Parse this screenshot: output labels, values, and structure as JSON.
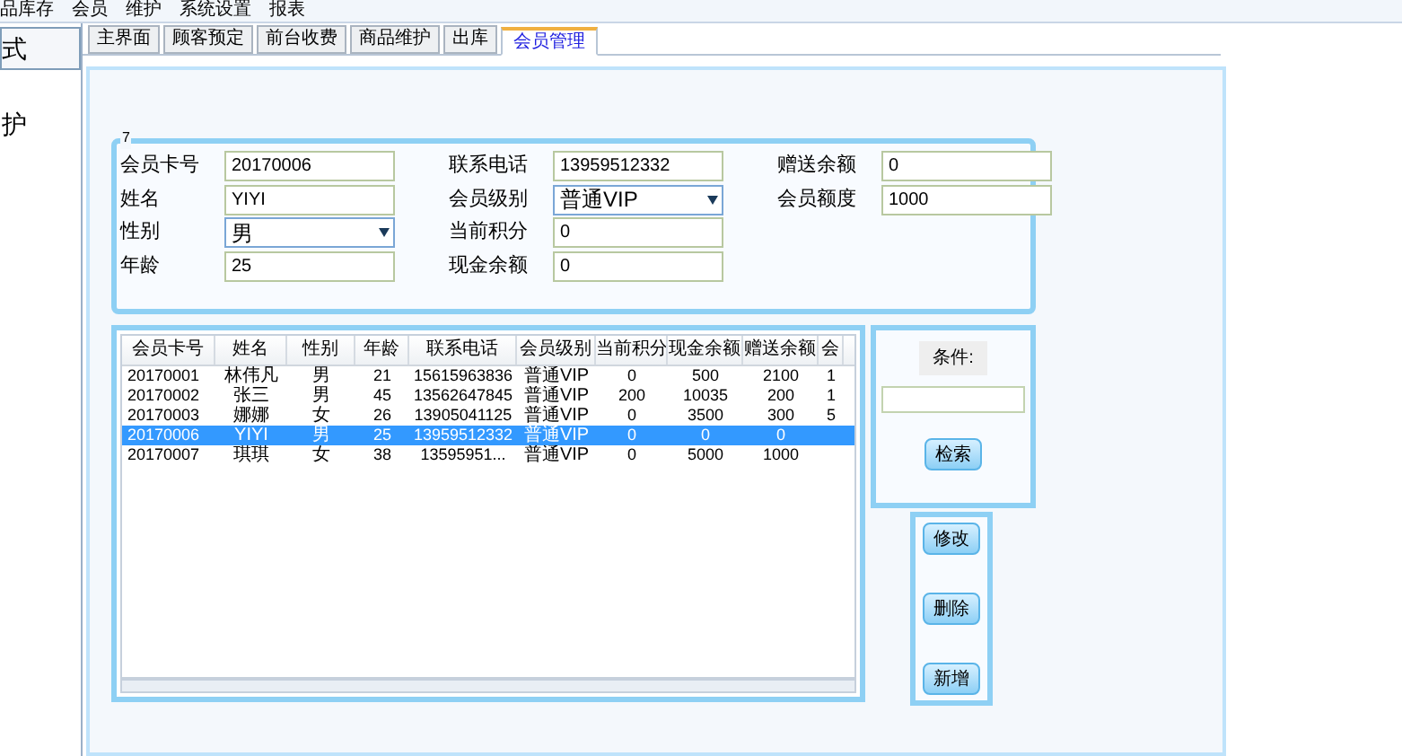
{
  "menu": [
    "品库存",
    "会员",
    "维护",
    "系统设置",
    "报表"
  ],
  "sidebar": [
    {
      "label": "式",
      "selected": true
    },
    {
      "label": "护",
      "selected": false
    }
  ],
  "tabs": [
    {
      "label": "主界面",
      "selected": false
    },
    {
      "label": "顾客预定",
      "selected": false
    },
    {
      "label": "前台收费",
      "selected": false
    },
    {
      "label": "商品维护",
      "selected": false
    },
    {
      "label": "出库",
      "selected": false
    },
    {
      "label": "会员管理",
      "selected": true
    }
  ],
  "form": {
    "title": "7",
    "fields": [
      {
        "label": "会员卡号",
        "value": "20170006",
        "kind": "text"
      },
      {
        "label": "联系电话",
        "value": "13959512332",
        "kind": "text"
      },
      {
        "label": "赠送余额",
        "value": "0",
        "kind": "text"
      },
      {
        "label": "姓名",
        "value": "YIYI",
        "kind": "text"
      },
      {
        "label": "会员级别",
        "value": "普通VIP",
        "kind": "select"
      },
      {
        "label": "会员额度",
        "value": "1000",
        "kind": "text"
      },
      {
        "label": "性别",
        "value": "男",
        "kind": "select"
      },
      {
        "label": "当前积分",
        "value": "0",
        "kind": "text"
      },
      {
        "label": "年龄",
        "value": "25",
        "kind": "text"
      },
      {
        "label": "现金余额",
        "value": "0",
        "kind": "text"
      }
    ]
  },
  "table": {
    "columns": [
      "会员卡号",
      "姓名",
      "性别",
      "年龄",
      "联系电话",
      "会员级别",
      "当前积分",
      "现金余额",
      "赠送余额",
      "会"
    ],
    "rows": [
      {
        "cells": [
          "20170001",
          "林伟凡",
          "男",
          "21",
          "15615963836",
          "普通VIP",
          "0",
          "500",
          "2100",
          "1"
        ],
        "selected": false
      },
      {
        "cells": [
          "20170002",
          "张三",
          "男",
          "45",
          "13562647845",
          "普通VIP",
          "200",
          "10035",
          "200",
          "1"
        ],
        "selected": false
      },
      {
        "cells": [
          "20170003",
          "娜娜",
          "女",
          "26",
          "13905041125",
          "普通VIP",
          "0",
          "3500",
          "300",
          "5"
        ],
        "selected": false
      },
      {
        "cells": [
          "20170006",
          "YIYI",
          "男",
          "25",
          "13959512332",
          "普通VIP",
          "0",
          "0",
          "0",
          ""
        ],
        "selected": true
      },
      {
        "cells": [
          "20170007",
          "琪琪",
          "女",
          "38",
          "13595951...",
          "普通VIP",
          "0",
          "5000",
          "1000",
          ""
        ],
        "selected": false
      }
    ]
  },
  "search": {
    "label": "条件:",
    "button": "检索"
  },
  "actions": [
    "修改",
    "删除",
    "新增"
  ]
}
